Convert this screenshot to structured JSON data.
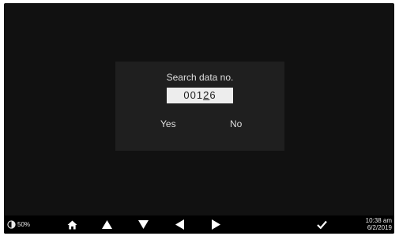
{
  "dialog": {
    "title": "Search data no.",
    "value_prefix": "001",
    "value_cursor_digit": "2",
    "value_suffix": "6",
    "yes_label": "Yes",
    "no_label": "No"
  },
  "status_bar": {
    "battery_percent": "50%",
    "battery_icon": "battery-pie-icon",
    "home_icon": "home-icon",
    "up_icon": "arrow-up-icon",
    "down_icon": "arrow-down-icon",
    "left_icon": "arrow-left-icon",
    "right_icon": "arrow-right-icon",
    "confirm_icon": "checkmark-icon",
    "time": "10:38 am",
    "date": "6/2/2019"
  },
  "colors": {
    "screen_background": "#111111",
    "dialog_background": "#1f1f1f",
    "input_background": "#ededed",
    "status_bar_background": "#000000",
    "text": "#dedede"
  }
}
